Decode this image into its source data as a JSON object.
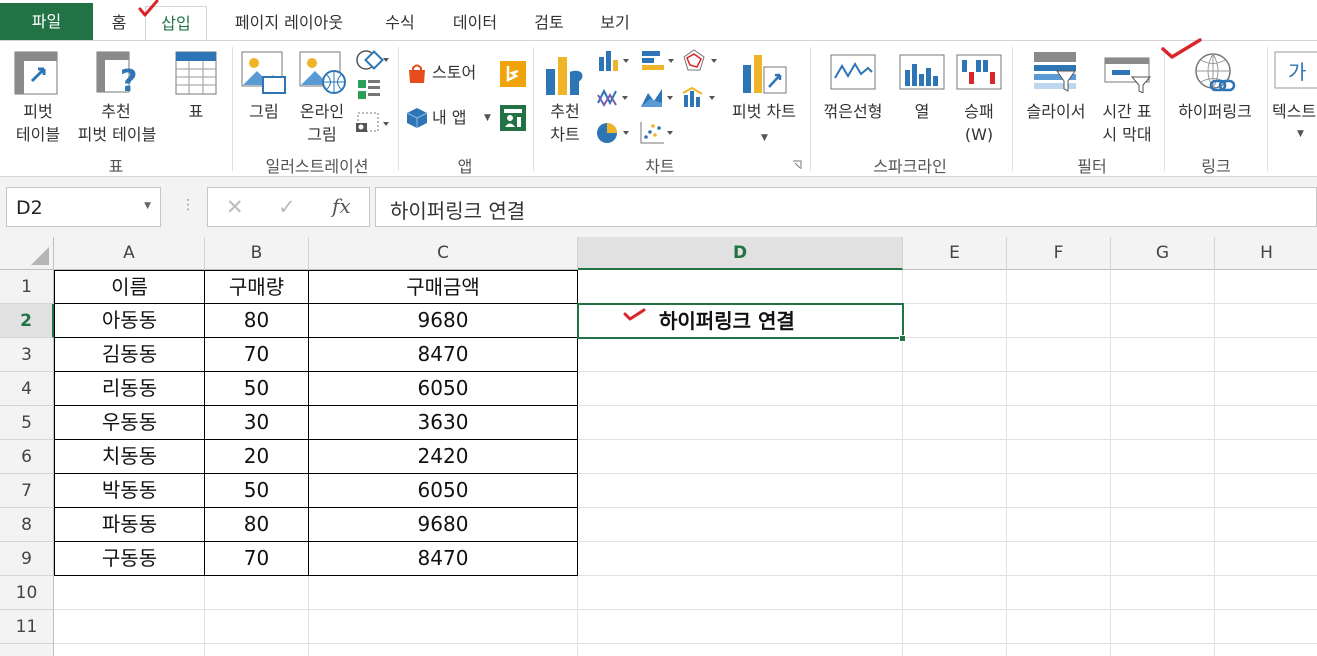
{
  "tabs": [
    "파일",
    "홈",
    "삽입",
    "페이지 레이아웃",
    "수식",
    "데이터",
    "검토",
    "보기"
  ],
  "active_tab": "삽입",
  "ribbon": {
    "pivot_table": [
      "피벗",
      "테이블"
    ],
    "recommended_pivot": [
      "추천",
      "피벗 테이블"
    ],
    "table": "표",
    "group_tables": "표",
    "picture": "그림",
    "online_picture": [
      "온라인",
      "그림"
    ],
    "group_illustrations": "일러스트레이션",
    "store": "스토어",
    "my_apps": "내 앱",
    "group_apps": "앱",
    "recommended_charts": [
      "추천",
      "차트"
    ],
    "pivot_chart": "피벗 차트",
    "group_charts": "차트",
    "spark_line": "꺾은선형",
    "spark_column": "열",
    "spark_winloss": [
      "승패",
      "(W)"
    ],
    "group_sparklines": "스파크라인",
    "slicer": "슬라이서",
    "timeline": [
      "시간 표",
      "시 막대"
    ],
    "group_filters": "필터",
    "hyperlink": "하이퍼링크",
    "group_links": "링크",
    "text": "텍스트"
  },
  "name_box": "D2",
  "formula_content": "하이퍼링크 연결",
  "accent_color": "#217346",
  "columns": [
    "A",
    "B",
    "C",
    "D",
    "E",
    "F",
    "G",
    "H"
  ],
  "selected_column": "D",
  "rows": [
    "1",
    "2",
    "3",
    "4",
    "5",
    "6",
    "7",
    "8",
    "9",
    "10",
    "11"
  ],
  "selected_row": "2",
  "table": {
    "headers": [
      "이름",
      "구매량",
      "구매금액"
    ],
    "data": [
      [
        "아동동",
        "80",
        "9680"
      ],
      [
        "김동동",
        "70",
        "8470"
      ],
      [
        "리동동",
        "50",
        "6050"
      ],
      [
        "우동동",
        "30",
        "3630"
      ],
      [
        "치동동",
        "20",
        "2420"
      ],
      [
        "박동동",
        "50",
        "6050"
      ],
      [
        "파동동",
        "80",
        "9680"
      ],
      [
        "구동동",
        "70",
        "8470"
      ]
    ]
  },
  "active_cell_text": "하이퍼링크 연결"
}
